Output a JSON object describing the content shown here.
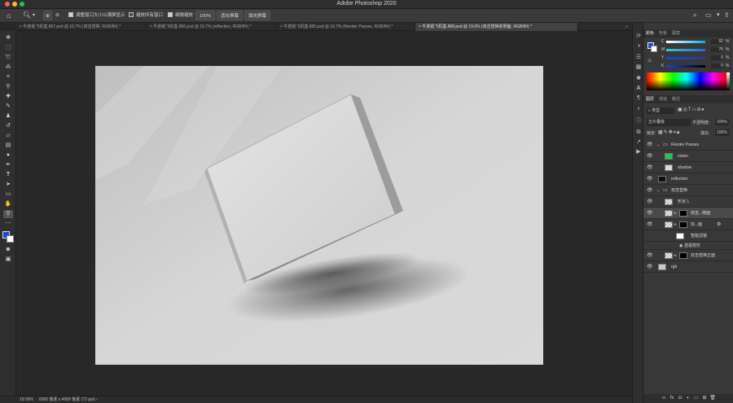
{
  "app": {
    "title": "Adobe Photoshop 2020"
  },
  "window_controls": {
    "close_color": "#ff5f57",
    "min_color": "#febc2e",
    "max_color": "#28c840"
  },
  "options_bar": {
    "resize_windows_label": "调整窗口大小以满屏显示",
    "zoom_all_windows_label": "缩放所有窗口",
    "scrubby_zoom_label": "细微缩放",
    "zoom_value": "100%",
    "fit_screen_label": "适合屏幕",
    "fill_screen_label": "填充屏幕"
  },
  "tabs": [
    {
      "label": "牛皮纸飞机盒.867.psd @ 16.7% (双击替换, RGB/8#) *"
    },
    {
      "label": "牛皮纸飞机盒.866.psd @ 16.7% (reflection, RGB/8#) *"
    },
    {
      "label": "牛皮纸飞机盒.865.psd @ 16.7% (Render Passes, RGB/8#) *"
    },
    {
      "label": "牛皮纸飞机盒.868.psd @ 19.6% (双击替换前侧面, RGB/8#) *"
    }
  ],
  "status": {
    "zoom": "19.59%",
    "doc_info": "6000 像素 x 4000 像素 (72 ppi)"
  },
  "color_panel": {
    "tabs": [
      "颜色",
      "色板",
      "图案"
    ],
    "sliders": [
      {
        "label": "C",
        "value": "92",
        "unit": "%"
      },
      {
        "label": "M",
        "value": "76",
        "unit": "%"
      },
      {
        "label": "Y",
        "value": "0",
        "unit": "%"
      },
      {
        "label": "K",
        "value": "0",
        "unit": "%"
      }
    ],
    "foreground_color": "#1846d6"
  },
  "layers_panel": {
    "tabs": [
      "图层",
      "通道",
      "路径"
    ],
    "filter_kind": "类型",
    "blend_mode": "正片叠底",
    "opacity_label": "不透明度:",
    "opacity_value": "100%",
    "lock_label": "锁定:",
    "fill_label": "填充:",
    "fill_value": "100%",
    "layers": [
      {
        "name": "Render Passes",
        "kind": "group"
      },
      {
        "name": "clown",
        "kind": "layer",
        "thumb": "#27c44a"
      },
      {
        "name": "shadow",
        "kind": "layer",
        "thumb": "#d8d8d8"
      },
      {
        "name": "reflection",
        "kind": "layer",
        "thumb": "#101010"
      },
      {
        "name": "双击替换",
        "kind": "group"
      },
      {
        "name": "形状 1",
        "kind": "layer",
        "thumb": "#9a9a9a"
      },
      {
        "name": "双击...侧面",
        "kind": "smart",
        "thumb": "#9a9a9a",
        "selected": true
      },
      {
        "name": "双...面",
        "kind": "smart",
        "thumb": "#9a9a9a"
      },
      {
        "name": "智能滤镜",
        "kind": "filter",
        "thumb": "#ffffff"
      },
      {
        "name": "透视变形",
        "kind": "filter-item"
      },
      {
        "name": "双击替换正面",
        "kind": "smart",
        "thumb": "#9a9a9a"
      },
      {
        "name": "rgb",
        "kind": "layer",
        "thumb": "#c9c9c9"
      }
    ]
  }
}
